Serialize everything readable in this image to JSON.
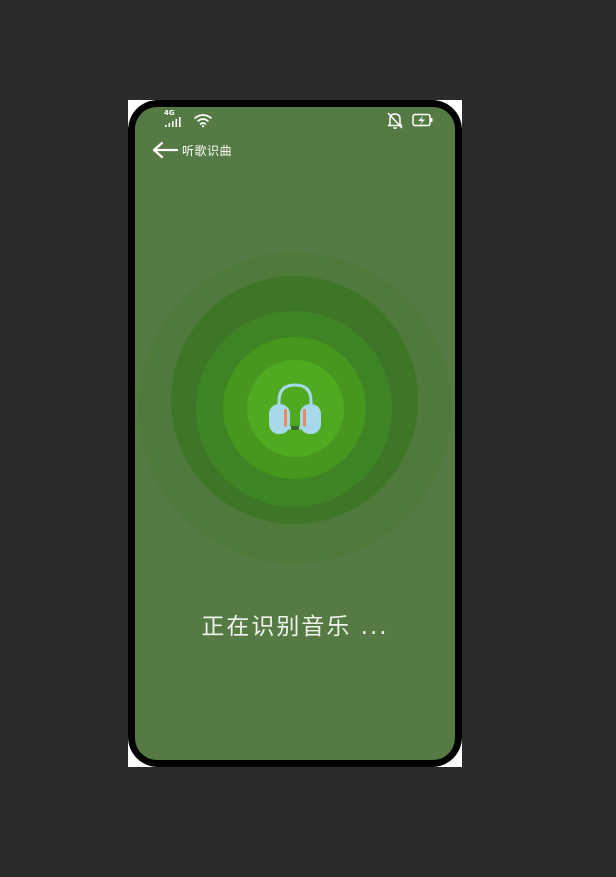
{
  "status_bar": {
    "network_label": "4G",
    "icons": [
      "signal-icon",
      "wifi-icon",
      "bell-off-icon",
      "battery-charging-icon"
    ]
  },
  "nav": {
    "back_icon": "arrow-left-icon",
    "title": "听歌识曲"
  },
  "center": {
    "icon": "headphones-icon"
  },
  "status_text": "正在识别音乐 ...",
  "colors": {
    "background": "#557a44",
    "ring_outer": "#4f7a3c",
    "ring_2": "#3e7628",
    "ring_3": "#3f8424",
    "ring_4": "#46961f",
    "ring_center": "#4faa20",
    "headphone_cup": "#a8d8ec",
    "headphone_accent": "#ec8b5a"
  }
}
